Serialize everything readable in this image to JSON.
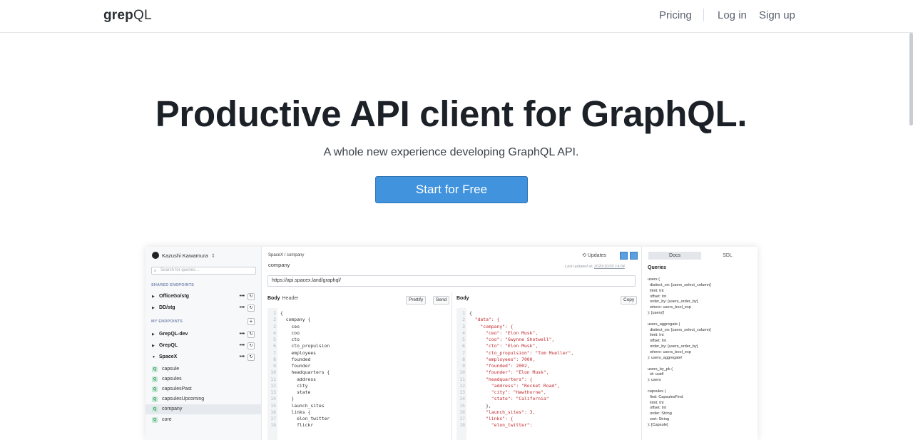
{
  "nav": {
    "logo_bold": "grep",
    "logo_rest": "QL",
    "pricing": "Pricing",
    "login": "Log in",
    "signup": "Sign up"
  },
  "hero": {
    "title": "Productive API client for GraphQL.",
    "subtitle": "A whole new experience developing GraphQL API.",
    "cta": "Start for Free"
  },
  "app": {
    "user": "Kazushi Kawamura",
    "search_placeholder": "Search for queries...",
    "shared_heading": "SHARED ENDPOINTS",
    "my_heading": "MY ENDPOINTS",
    "shared_endpoints": [
      "OfficeGo/stg",
      "DD/stg"
    ],
    "my_endpoints": [
      "GrepQL-dev",
      "GrepQL",
      "SpaceX"
    ],
    "queries": [
      "capsule",
      "capsules",
      "capsulesPast",
      "capsulesUpcoming",
      "company",
      "core"
    ],
    "breadcrumb": "SpaceX / company",
    "query_name": "company",
    "updates": "Updates",
    "last_updated_label": "Last updated at:",
    "last_updated_value": "2020/10/30 14:04",
    "url": "https://api.spacex.land/graphql/",
    "body_label": "Body",
    "header_label": "Header",
    "prettify": "Prettify",
    "send": "Send",
    "copy": "Copy",
    "query_lines": [
      "{",
      "  company {",
      "    ceo",
      "    coo",
      "    cto",
      "    cto_propulsion",
      "    employees",
      "    founded",
      "    founder",
      "    headquarters {",
      "      address",
      "      city",
      "      state",
      "    }",
      "    launch_sites",
      "    links {",
      "      elon_twitter",
      "      flickr"
    ],
    "result_lines": [
      "{",
      "  \"data\": {",
      "    \"company\": {",
      "      \"ceo\": \"Elon Musk\",",
      "      \"coo\": \"Gwynne Shotwell\",",
      "      \"cto\": \"Elon Musk\",",
      "      \"cto_propulsion\": \"Tom Mueller\",",
      "      \"employees\": 7000,",
      "      \"founded\": 2002,",
      "      \"founder\": \"Elon Musk\",",
      "      \"headquarters\": {",
      "        \"address\": \"Rocket Road\",",
      "        \"city\": \"Hawthorne\",",
      "        \"state\": \"California\"",
      "      },",
      "      \"launch_sites\": 3,",
      "      \"links\": {",
      "        \"elon_twitter\":"
    ],
    "docs_tab": "Docs",
    "sdl_tab": "SDL",
    "queries_title": "Queries",
    "docs_text": "users (\n  distinct_on: [users_select_column]\n  limit: Int\n  offset: Int\n  order_by: [users_order_by]\n  where: users_bool_exp\n): [users]!\n\nusers_aggregate (\n  distinct_on: [users_select_column]\n  limit: Int\n  offset: Int\n  order_by: [users_order_by]\n  where: users_bool_exp\n): users_aggregate!\n\nusers_by_pk (\n  id: uuid!\n): users\n\ncapsules (\n  find: CapsulesFind\n  limit: Int\n  offset: Int\n  order: String\n  sort: String\n): [Capsule]"
  }
}
